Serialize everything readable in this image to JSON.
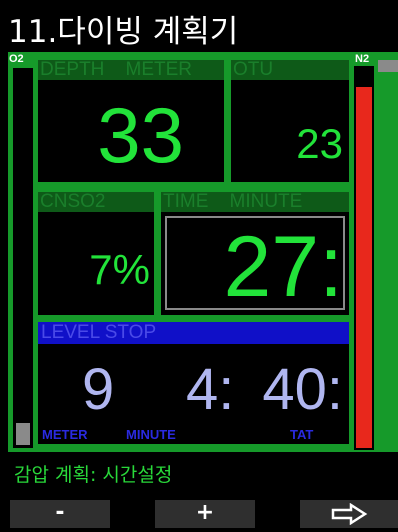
{
  "title": "11.다이빙 계획기",
  "gauges": {
    "left_label": "O2",
    "right_label": "N2",
    "o2_fill_fraction": 0.06,
    "n2_fill_fraction": 0.95
  },
  "panels": {
    "depth": {
      "header": "DEPTH    METER",
      "value": "33"
    },
    "otu": {
      "header": "OTU",
      "value": "23"
    },
    "cns": {
      "header": "CNSO2",
      "value": "7%"
    },
    "time": {
      "header": "TIME    MINUTE",
      "value": "27:"
    }
  },
  "level_stop": {
    "header": "LEVEL  STOP",
    "depth_value": "9",
    "depth_unit": "METER",
    "time_value": "4:",
    "time_unit": "MINUTE",
    "tat_value": "40:",
    "tat_unit": "TAT"
  },
  "status_text": "감압 계획: 시간설정",
  "softkeys": {
    "minus": "-",
    "plus": "+",
    "next_icon": "arrow-right-outline-icon"
  },
  "colors": {
    "accent_green": "#22e33a",
    "frame_green": "#169a2a",
    "level_blue": "#1010c8",
    "n2_red": "#e8281c"
  }
}
